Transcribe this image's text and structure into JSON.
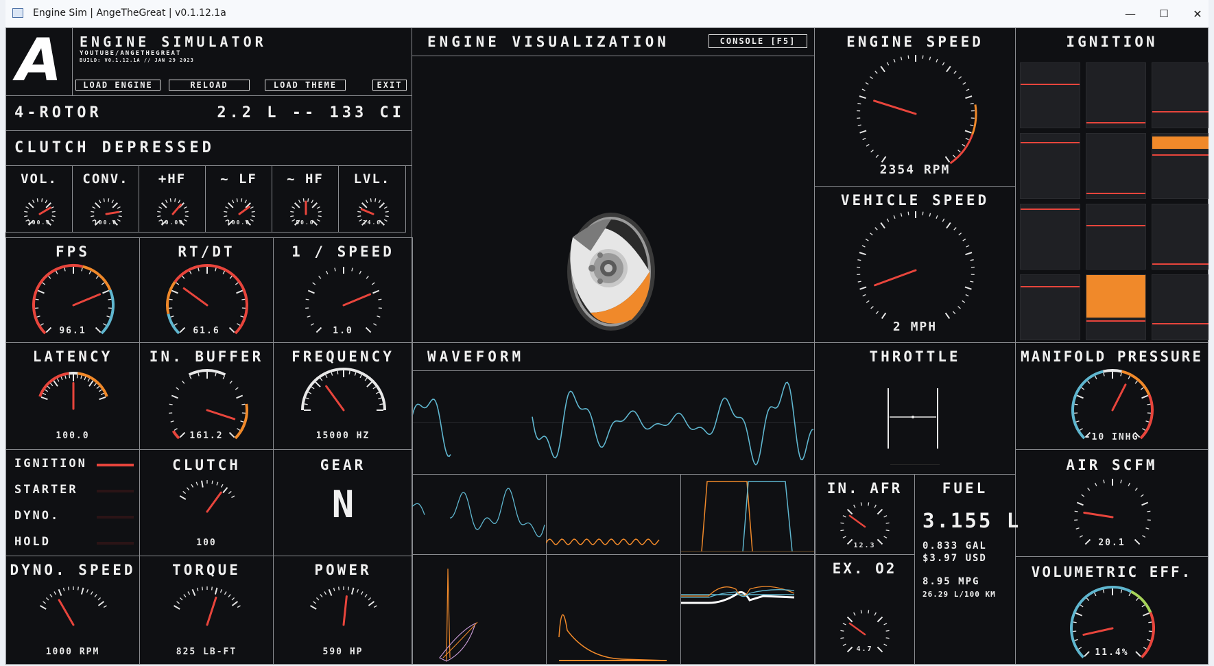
{
  "window": {
    "title": "Engine Sim | AngeTheGreat | v0.1.12.1a",
    "minimize": "—",
    "maximize": "☐",
    "close": "✕"
  },
  "header": {
    "logo": "A",
    "app_name": "ENGINE SIMULATOR",
    "channel": "YOUTUBE/ANGETHEGREAT",
    "build": "BUILD: V0.1.12.1A // JAN 29 2023",
    "buttons": {
      "load_engine": "LOAD ENGINE",
      "reload": "RELOAD",
      "load_theme": "LOAD THEME",
      "exit": "EXIT"
    }
  },
  "engine": {
    "name": "4-ROTOR",
    "displacement": "2.2 L -- 133 CI",
    "clutch_status": "CLUTCH DEPRESSED"
  },
  "small_gauges": [
    {
      "label": "VOL.",
      "value": "100.0",
      "fraction": 0.72
    },
    {
      "label": "CONV.",
      "value": "100.0",
      "fraction": 0.8
    },
    {
      "label": "+HF",
      "value": "10.00",
      "fraction": 0.65
    },
    {
      "label": "~ LF",
      "value": "100.0",
      "fraction": 0.7
    },
    {
      "label": "~ HF",
      "value": "50.0",
      "fraction": 0.5
    },
    {
      "label": "LVL.",
      "value": "24.0",
      "fraction": 0.25
    }
  ],
  "mid_gauges": [
    {
      "label": "FPS",
      "value": "96.1",
      "fraction": 0.75
    },
    {
      "label": "RT/DT",
      "value": "61.6",
      "fraction": 0.3
    },
    {
      "label": "1 / SPEED",
      "value": "1.0",
      "fraction": 0.75
    }
  ],
  "lower_gauges": [
    {
      "label": "LATENCY",
      "value": "100.0",
      "fraction": 0.5
    },
    {
      "label": "IN. BUFFER",
      "value": "161.2",
      "fraction": 0.9
    },
    {
      "label": "FREQUENCY",
      "value": "15000 HZ",
      "fraction": 0.3
    }
  ],
  "indicators": [
    {
      "label": "IGNITION",
      "active": true
    },
    {
      "label": "STARTER",
      "active": false
    },
    {
      "label": "DYNO.",
      "active": false
    },
    {
      "label": "HOLD",
      "active": false
    }
  ],
  "clutch": {
    "label": "CLUTCH",
    "value": "100",
    "fraction": 0.8
  },
  "gear": {
    "label": "GEAR",
    "value": "N"
  },
  "bottom_gauges": [
    {
      "label": "DYNO. SPEED",
      "value": "1000 RPM",
      "fraction": 0.25
    },
    {
      "label": "TORQUE",
      "value": "825 LB-FT",
      "fraction": 0.65
    },
    {
      "label": "POWER",
      "value": "590 HP",
      "fraction": 0.55
    }
  ],
  "visualization": {
    "title": "ENGINE VISUALIZATION",
    "console_button": "CONSOLE [F5]"
  },
  "waveform": {
    "title": "WAVEFORM"
  },
  "engine_speed": {
    "title": "ENGINE SPEED",
    "value": "2354 RPM",
    "fraction": 0.25
  },
  "vehicle_speed": {
    "title": "VEHICLE SPEED",
    "value": "2 MPH",
    "fraction": 0.12
  },
  "ignition": {
    "title": "IGNITION"
  },
  "throttle": {
    "title": "THROTTLE"
  },
  "manifold": {
    "title": "MANIFOLD PRESSURE",
    "value": "-10 INHG",
    "fraction": 0.6
  },
  "air_scfm": {
    "title": "AIR SCFM",
    "value": "20.1",
    "fraction": 0.2
  },
  "vol_eff": {
    "title": "VOLUMETRIC EFF.",
    "value": "11.4%",
    "fraction": 0.12
  },
  "in_afr": {
    "title": "IN. AFR",
    "value": "12.3",
    "fraction": 0.3
  },
  "ex_o2": {
    "title": "EX. O2",
    "value": "4.7",
    "fraction": 0.3
  },
  "fuel": {
    "title": "FUEL",
    "liters": "3.155 L",
    "gallons": "0.833 GAL",
    "cost": "$3.97 USD",
    "mpg": "8.95 MPG",
    "lper100": "26.29 L/100 KM"
  },
  "colors": {
    "accent_red": "#e8453c",
    "accent_orange": "#f0892a",
    "accent_blue": "#5fb6cf",
    "grid": "#8a8c90",
    "background": "#0f1013"
  }
}
